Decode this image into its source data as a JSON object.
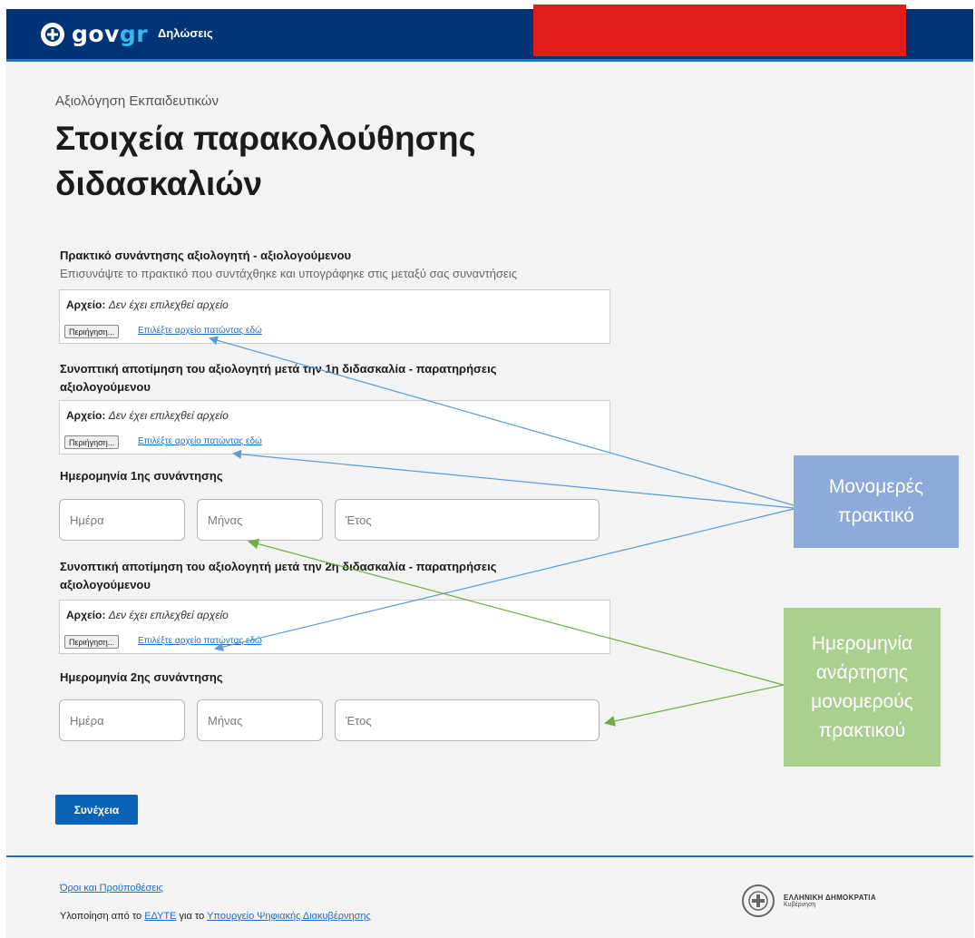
{
  "header": {
    "logo_gov": "gov",
    "logo_gr": "gr",
    "service_name": "Δηλώσεις"
  },
  "page": {
    "caption": "Αξιολόγηση Εκπαιδευτικών",
    "title": "Στοιχεία παρακολούθησης διδασκαλιών"
  },
  "section1": {
    "label": "Πρακτικό συνάντησης αξιολογητή - αξιολογούμενου",
    "hint": "Επισυνάψτε το πρακτικό που συντάχθηκε και υπογράφηκε στις μεταξύ σας συναντήσεις",
    "file_label": "Αρχείο:",
    "file_status": "Δεν έχει επιλεχθεί αρχείο",
    "browse": "Περιήγηση...",
    "choose_link": "Επιλέξτε αρχείο πατώντας εδώ"
  },
  "section2": {
    "label": "Συνοπτική αποτίμηση του αξιολογητή μετά την 1η διδασκαλία - παρατηρήσεις αξιολογούμενου",
    "file_label": "Αρχείο:",
    "file_status": "Δεν έχει επιλεχθεί αρχείο",
    "browse": "Περιήγηση...",
    "choose_link": "Επιλέξτε αρχείο πατώντας εδώ"
  },
  "date1": {
    "label": "Ημερομηνία 1ης συνάντησης",
    "day_placeholder": "Ημέρα",
    "month_placeholder": "Μήνας",
    "year_placeholder": "Έτος"
  },
  "section3": {
    "label": "Συνοπτική αποτίμηση του αξιολογητή μετά την 2η διδασκαλία - παρατηρήσεις αξιολογούμενου",
    "file_label": "Αρχείο:",
    "file_status": "Δεν έχει επιλεχθεί αρχείο",
    "browse": "Περιήγηση...",
    "choose_link": "Επιλέξτε αρχείο πατώντας εδώ"
  },
  "date2": {
    "label": "Ημερομηνία 2ης συνάντησης",
    "day_placeholder": "Ημέρα",
    "month_placeholder": "Μήνας",
    "year_placeholder": "Έτος"
  },
  "actions": {
    "continue": "Συνέχεια"
  },
  "footer": {
    "terms": "Όροι και Προϋποθέσεις",
    "credit_prefix": "Υλοποίηση από το ",
    "credit_org": "ΕΔΥΤΕ",
    "credit_middle": " για το ",
    "credit_ministry": "Υπουργείο Ψηφιακής Διακυβέρνησης",
    "gov_title": "ΕΛΛΗΝΙΚΗ ΔΗΜΟΚΡΑΤΙΑ",
    "gov_sub": "Κυβέρνηση"
  },
  "callouts": {
    "blue": [
      "Μονομερές",
      "πρακτικό"
    ],
    "green": [
      "Ημερομηνία",
      "ανάρτησης",
      "μονομερούς",
      "πρακτικού"
    ]
  },
  "colors": {
    "header_bg": "#003476",
    "accent": "#1f6fc5",
    "redaction": "#e21b1b",
    "callout_blue": "#8eaadb",
    "callout_green": "#a9d08e",
    "arrow_blue": "#5b9bd5",
    "arrow_green": "#70ad47"
  }
}
